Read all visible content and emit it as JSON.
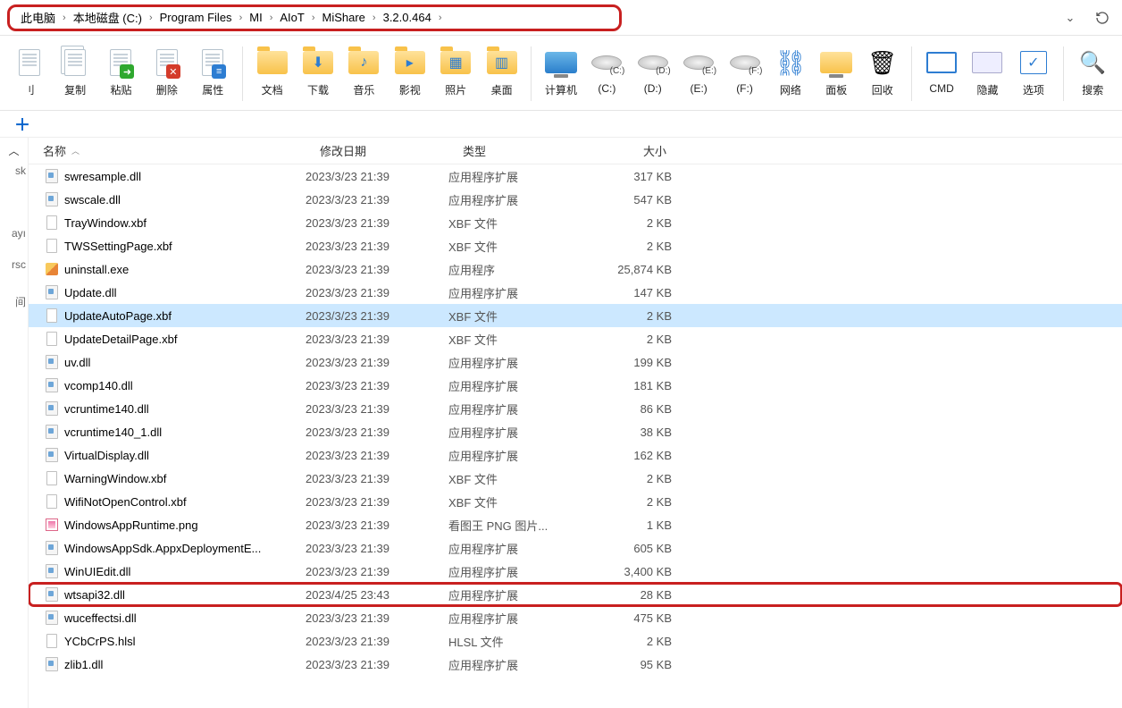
{
  "breadcrumb": [
    "此电脑",
    "本地磁盘 (C:)",
    "Program Files",
    "MI",
    "AIoT",
    "MiShare",
    "3.2.0.464"
  ],
  "toolbar": [
    {
      "id": "unknown-left",
      "label": "刂",
      "icon": "page"
    },
    {
      "id": "copy",
      "label": "复制",
      "icon": "page-two"
    },
    {
      "id": "paste",
      "label": "粘贴",
      "icon": "page-green"
    },
    {
      "id": "delete",
      "label": "删除",
      "icon": "page-red"
    },
    {
      "id": "properties",
      "label": "属性",
      "icon": "page-blue"
    },
    {
      "sep": true
    },
    {
      "id": "documents",
      "label": "文档",
      "icon": "folder"
    },
    {
      "id": "downloads",
      "label": "下载",
      "icon": "folder-down"
    },
    {
      "id": "music",
      "label": "音乐",
      "icon": "folder-music"
    },
    {
      "id": "videos",
      "label": "影视",
      "icon": "folder-video"
    },
    {
      "id": "pictures",
      "label": "照片",
      "icon": "folder-pic"
    },
    {
      "id": "desktop",
      "label": "桌面",
      "icon": "folder-desk"
    },
    {
      "sep": true
    },
    {
      "id": "computer",
      "label": "计算机",
      "icon": "monitor"
    },
    {
      "id": "drive-c",
      "label": "(C:)",
      "icon": "disk"
    },
    {
      "id": "drive-d",
      "label": "(D:)",
      "icon": "disk"
    },
    {
      "id": "drive-e",
      "label": "(E:)",
      "icon": "disk"
    },
    {
      "id": "drive-f",
      "label": "(F:)",
      "icon": "disk"
    },
    {
      "id": "network",
      "label": "网络",
      "icon": "net"
    },
    {
      "id": "panel",
      "label": "面板",
      "icon": "panel"
    },
    {
      "id": "recycle",
      "label": "回收",
      "icon": "recycle"
    },
    {
      "sep": true
    },
    {
      "id": "cmd",
      "label": "CMD",
      "icon": "cmd"
    },
    {
      "id": "hide",
      "label": "隐藏",
      "icon": "hide"
    },
    {
      "id": "options",
      "label": "选项",
      "icon": "options"
    },
    {
      "sep": true
    },
    {
      "id": "search",
      "label": "搜索",
      "icon": "search"
    }
  ],
  "columns": {
    "name": "名称",
    "date": "修改日期",
    "type": "类型",
    "size": "大小"
  },
  "sideLabels": [
    "sk",
    "ayı",
    "rsc",
    "间"
  ],
  "files": [
    {
      "name": "swresample.dll",
      "date": "2023/3/23 21:39",
      "type": "应用程序扩展",
      "size": "317 KB",
      "icon": "dll"
    },
    {
      "name": "swscale.dll",
      "date": "2023/3/23 21:39",
      "type": "应用程序扩展",
      "size": "547 KB",
      "icon": "dll"
    },
    {
      "name": "TrayWindow.xbf",
      "date": "2023/3/23 21:39",
      "type": "XBF 文件",
      "size": "2 KB",
      "icon": "xbf"
    },
    {
      "name": "TWSSettingPage.xbf",
      "date": "2023/3/23 21:39",
      "type": "XBF 文件",
      "size": "2 KB",
      "icon": "xbf"
    },
    {
      "name": "uninstall.exe",
      "date": "2023/3/23 21:39",
      "type": "应用程序",
      "size": "25,874 KB",
      "icon": "exe"
    },
    {
      "name": "Update.dll",
      "date": "2023/3/23 21:39",
      "type": "应用程序扩展",
      "size": "147 KB",
      "icon": "dll"
    },
    {
      "name": "UpdateAutoPage.xbf",
      "date": "2023/3/23 21:39",
      "type": "XBF 文件",
      "size": "2 KB",
      "icon": "xbf",
      "selected": true
    },
    {
      "name": "UpdateDetailPage.xbf",
      "date": "2023/3/23 21:39",
      "type": "XBF 文件",
      "size": "2 KB",
      "icon": "xbf"
    },
    {
      "name": "uv.dll",
      "date": "2023/3/23 21:39",
      "type": "应用程序扩展",
      "size": "199 KB",
      "icon": "dll"
    },
    {
      "name": "vcomp140.dll",
      "date": "2023/3/23 21:39",
      "type": "应用程序扩展",
      "size": "181 KB",
      "icon": "dll"
    },
    {
      "name": "vcruntime140.dll",
      "date": "2023/3/23 21:39",
      "type": "应用程序扩展",
      "size": "86 KB",
      "icon": "dll"
    },
    {
      "name": "vcruntime140_1.dll",
      "date": "2023/3/23 21:39",
      "type": "应用程序扩展",
      "size": "38 KB",
      "icon": "dll"
    },
    {
      "name": "VirtualDisplay.dll",
      "date": "2023/3/23 21:39",
      "type": "应用程序扩展",
      "size": "162 KB",
      "icon": "dll"
    },
    {
      "name": "WarningWindow.xbf",
      "date": "2023/3/23 21:39",
      "type": "XBF 文件",
      "size": "2 KB",
      "icon": "xbf"
    },
    {
      "name": "WifiNotOpenControl.xbf",
      "date": "2023/3/23 21:39",
      "type": "XBF 文件",
      "size": "2 KB",
      "icon": "xbf"
    },
    {
      "name": "WindowsAppRuntime.png",
      "date": "2023/3/23 21:39",
      "type": "看图王 PNG 图片...",
      "size": "1 KB",
      "icon": "png"
    },
    {
      "name": "WindowsAppSdk.AppxDeploymentE...",
      "date": "2023/3/23 21:39",
      "type": "应用程序扩展",
      "size": "605 KB",
      "icon": "dll"
    },
    {
      "name": "WinUIEdit.dll",
      "date": "2023/3/23 21:39",
      "type": "应用程序扩展",
      "size": "3,400 KB",
      "icon": "dll"
    },
    {
      "name": "wtsapi32.dll",
      "date": "2023/4/25 23:43",
      "type": "应用程序扩展",
      "size": "28 KB",
      "icon": "dll",
      "highlighted": true
    },
    {
      "name": "wuceffectsi.dll",
      "date": "2023/3/23 21:39",
      "type": "应用程序扩展",
      "size": "475 KB",
      "icon": "dll"
    },
    {
      "name": "YCbCrPS.hlsl",
      "date": "2023/3/23 21:39",
      "type": "HLSL 文件",
      "size": "2 KB",
      "icon": "hlsl"
    },
    {
      "name": "zlib1.dll",
      "date": "2023/3/23 21:39",
      "type": "应用程序扩展",
      "size": "95 KB",
      "icon": "dll"
    }
  ]
}
